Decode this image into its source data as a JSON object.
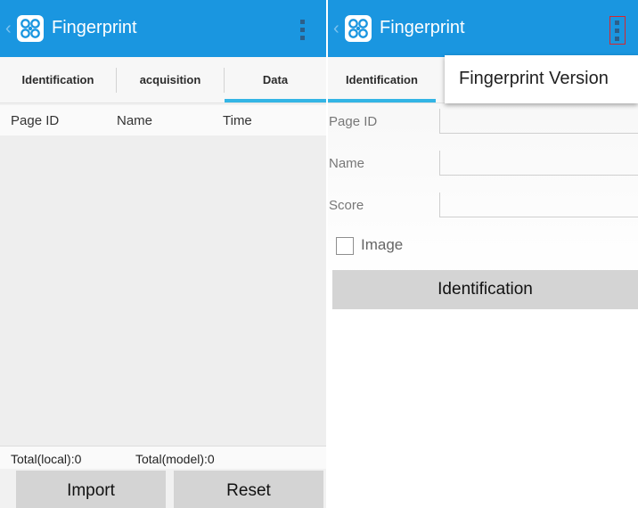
{
  "left": {
    "app_title": "Fingerprint",
    "tabs": [
      {
        "label": "Identification"
      },
      {
        "label": "acquisition"
      },
      {
        "label": "Data"
      }
    ],
    "active_tab": "Data",
    "table": {
      "columns": [
        "Page ID",
        "Name",
        "Time"
      ],
      "rows": []
    },
    "totals": {
      "local": "Total(local):0",
      "model": "Total(model):0"
    },
    "buttons": {
      "import": "Import",
      "reset": "Reset"
    }
  },
  "right": {
    "app_title": "Fingerprint",
    "active_tab": "Identification",
    "tab_label": "Identification",
    "form": {
      "page_id_label": "Page ID",
      "name_label": "Name",
      "score_label": "Score",
      "page_id_value": "",
      "name_value": "",
      "score_value": ""
    },
    "image_checkbox": {
      "label": "Image",
      "checked": false
    },
    "identify_button": "Identification",
    "menu": {
      "items": [
        "Fingerprint Version"
      ]
    }
  },
  "colors": {
    "action_bar": "#1a96e0",
    "tab_indicator": "#33b5e5",
    "button_gray": "#d4d4d4",
    "overflow_highlight": "#d8262c"
  },
  "icons": {
    "app": "fingerprint-app-icon",
    "back": "chevron-left-icon",
    "overflow": "overflow-menu-icon"
  }
}
